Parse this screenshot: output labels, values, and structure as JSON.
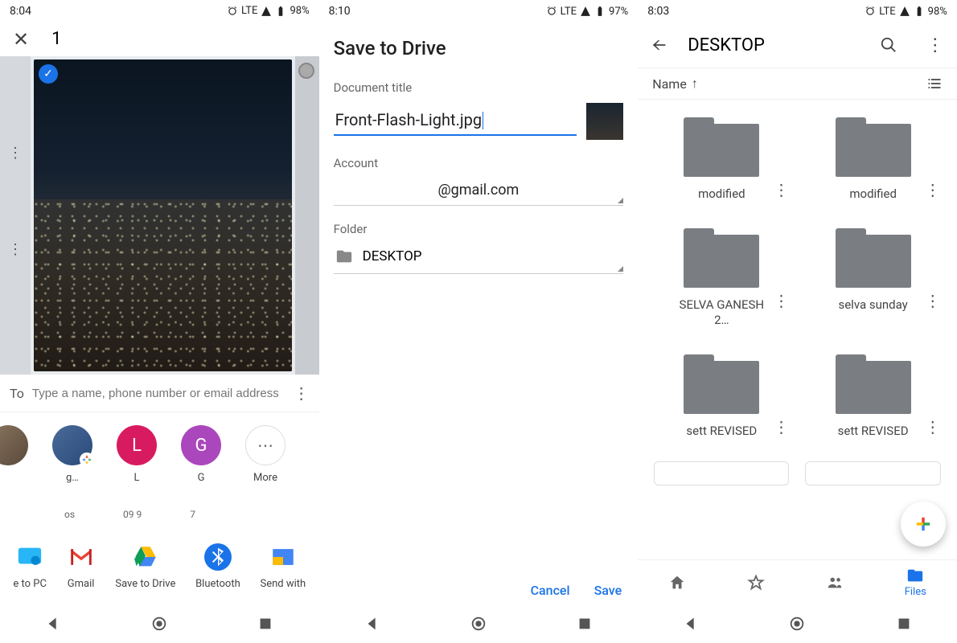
{
  "screen1": {
    "status_time": "8:04",
    "status_net": "LTE",
    "status_batt": "98%",
    "count": "1",
    "to_label": "To",
    "to_placeholder": "Type a name, phone number or email address",
    "contacts": [
      {
        "label": "",
        "sub": ""
      },
      {
        "label": "g…",
        "sub": "os"
      },
      {
        "label": "L",
        "sub": "09  9"
      },
      {
        "label": "G",
        "sub": "7"
      },
      {
        "label": "More",
        "sub": ""
      }
    ],
    "apps": [
      {
        "label": "e to PC"
      },
      {
        "label": "Gmail"
      },
      {
        "label": "Save to Drive"
      },
      {
        "label": "Bluetooth"
      },
      {
        "label": "Send with"
      }
    ]
  },
  "screen2": {
    "status_time": "8:10",
    "status_net": "LTE",
    "status_batt": "97%",
    "title": "Save to Drive",
    "doc_title_label": "Document title",
    "doc_title_value": "Front-Flash-Light.jpg",
    "account_label": "Account",
    "account_value": "@gmail.com",
    "folder_label": "Folder",
    "folder_value": "DESKTOP",
    "cancel": "Cancel",
    "save": "Save"
  },
  "screen3": {
    "status_time": "8:03",
    "status_net": "LTE",
    "status_batt": "98%",
    "title": "DESKTOP",
    "sort_label": "Name",
    "folders": [
      "modified",
      "modified",
      "SELVA GANESH 2…",
      "selva sunday",
      "sett REVISED",
      "sett REVISED"
    ],
    "bottom": {
      "files": "Files"
    }
  }
}
